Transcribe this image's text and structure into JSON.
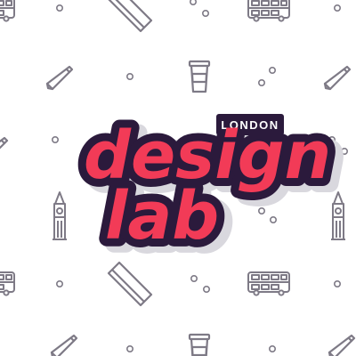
{
  "logo": {
    "line1": "design",
    "line2": "lab",
    "city": "LONDON"
  },
  "colors": {
    "background": "#ffffff",
    "icon_stroke": "#7e7a86",
    "logo_fill": "#f23b57",
    "logo_outline": "#2b1a3c",
    "logo_shadow": "#d9d8de",
    "city_text": "#ffffff"
  },
  "pattern_icons": [
    "pencil-icon",
    "book-icon",
    "bus-icon",
    "coffee-cup-icon",
    "big-ben-icon",
    "dot"
  ]
}
